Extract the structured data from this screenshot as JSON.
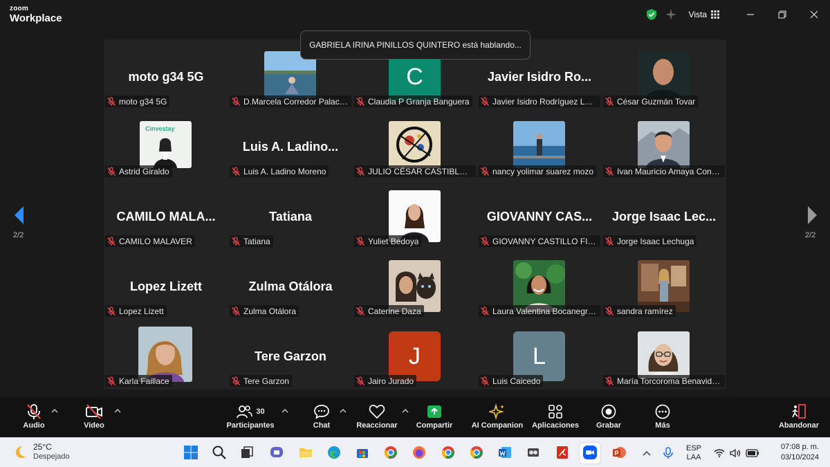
{
  "app": {
    "logo_line1": "zoom",
    "logo_line2": "Workplace",
    "view_label": "Vista"
  },
  "speaker_notice": "GABRIELA IRINA PINILLOS QUINTERO está hablando...",
  "pagination": {
    "left": "2/2",
    "right": "2/2"
  },
  "participants": [
    {
      "label": "moto g34 5G",
      "big": "moto g34 5G",
      "kind": "name"
    },
    {
      "label": "D.Marcela Corredor Palacios",
      "kind": "photo",
      "photo": "sea"
    },
    {
      "label": "Claudia P Granja Banguera",
      "kind": "letter",
      "letter": "C",
      "color": "#0b8a70"
    },
    {
      "label": "Javier Isidro Rodríguez López",
      "big": "Javier  Isidro  Ro...",
      "kind": "name"
    },
    {
      "label": "César Guzmán Tovar",
      "kind": "photo",
      "photo": "man-dark"
    },
    {
      "label": "Astrid Giraldo",
      "kind": "photo",
      "photo": "office"
    },
    {
      "label": "Luis A. Ladino Moreno",
      "big": "Luis  A.  Ladino...",
      "kind": "name"
    },
    {
      "label": "JULIO CÉSAR CASTIBLANCO",
      "kind": "photo",
      "photo": "art"
    },
    {
      "label": "nancy yolimar suarez mozo",
      "kind": "photo",
      "photo": "sea2"
    },
    {
      "label": "Ivan Mauricio Amaya Contre...",
      "kind": "photo",
      "photo": "man-suit"
    },
    {
      "label": "CAMILO MALAVER",
      "big": "CAMILO  MALA...",
      "kind": "name"
    },
    {
      "label": "Tatiana",
      "big": "Tatiana",
      "kind": "name"
    },
    {
      "label": "Yuliet Bedoya",
      "kind": "photo",
      "photo": "woman-white"
    },
    {
      "label": "GIOVANNY CASTILLO FIGUE...",
      "big": "GIOVANNY  CAS...",
      "kind": "name"
    },
    {
      "label": "Jorge Isaac Lechuga",
      "big": "Jorge  Isaac  Lec...",
      "kind": "name"
    },
    {
      "label": "Lopez Lizett",
      "big": "Lopez Lizett",
      "kind": "name"
    },
    {
      "label": "Zulma Otálora",
      "big": "Zulma Otálora",
      "kind": "name"
    },
    {
      "label": "Caterine Daza",
      "kind": "photo",
      "photo": "cat"
    },
    {
      "label": "Laura Valentina Bocanegra ...",
      "kind": "photo",
      "photo": "woman-green"
    },
    {
      "label": "sandra ramírez",
      "kind": "photo",
      "photo": "studio"
    },
    {
      "label": "Karla Faillace",
      "kind": "photo",
      "photo": "woman-blonde"
    },
    {
      "label": "Tere Garzon",
      "big": "Tere Garzon",
      "kind": "name"
    },
    {
      "label": "Jairo Jurado",
      "kind": "letter",
      "letter": "J",
      "color": "#c23a14"
    },
    {
      "label": "Luis Caicedo",
      "kind": "letter",
      "letter": "L",
      "color": "#64808c"
    },
    {
      "label": "María Torcoroma Benavides ...",
      "kind": "photo",
      "photo": "woman-glasses"
    }
  ],
  "toolbar": {
    "audio": "Audio",
    "video": "Video",
    "participants": "Participantes",
    "participants_count": "30",
    "chat": "Chat",
    "react": "Reaccionar",
    "share": "Compartir",
    "companion": "AI Companion",
    "apps": "Aplicaciones",
    "record": "Grabar",
    "more": "Más",
    "leave": "Abandonar"
  },
  "taskbar": {
    "temperature": "25°C",
    "weather": "Despejado",
    "lang1": "ESP",
    "lang2": "LAA",
    "time": "07:08 p. m.",
    "date": "03/10/2024"
  },
  "colors": {
    "share_green": "#1fb255",
    "mute_red": "#e5484d",
    "nav_blue": "#2d8cff"
  }
}
